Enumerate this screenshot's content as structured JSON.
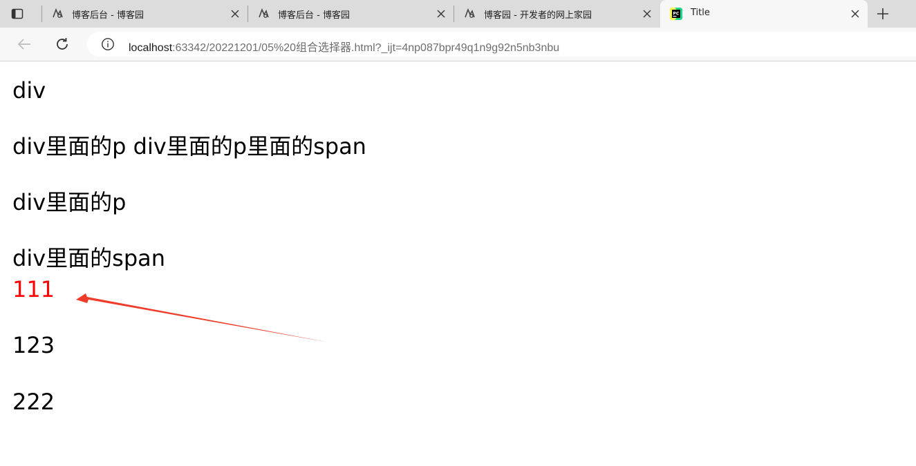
{
  "browser": {
    "tabs": [
      {
        "title": "博客后台 - 博客园",
        "icon": "cnblogs-icon",
        "active": false
      },
      {
        "title": "博客后台 - 博客园",
        "icon": "cnblogs-icon",
        "active": false
      },
      {
        "title": "博客园 - 开发者的网上家园",
        "icon": "cnblogs-icon",
        "active": false
      },
      {
        "title": "Title",
        "icon": "pycharm-icon",
        "active": true
      }
    ],
    "address": {
      "host": "localhost",
      "rest": ":63342/20221201/05%20组合选择器.html?_ijt=4np087bpr49q1n9g92n5nb3nbu"
    }
  },
  "page": {
    "lines": [
      "div",
      "div里面的p div里面的p里面的span",
      "div里面的p",
      "div里面的span",
      "111",
      "123",
      "222"
    ],
    "highlight_color": "#ff0000",
    "arrow_color": "#f03c2a"
  }
}
